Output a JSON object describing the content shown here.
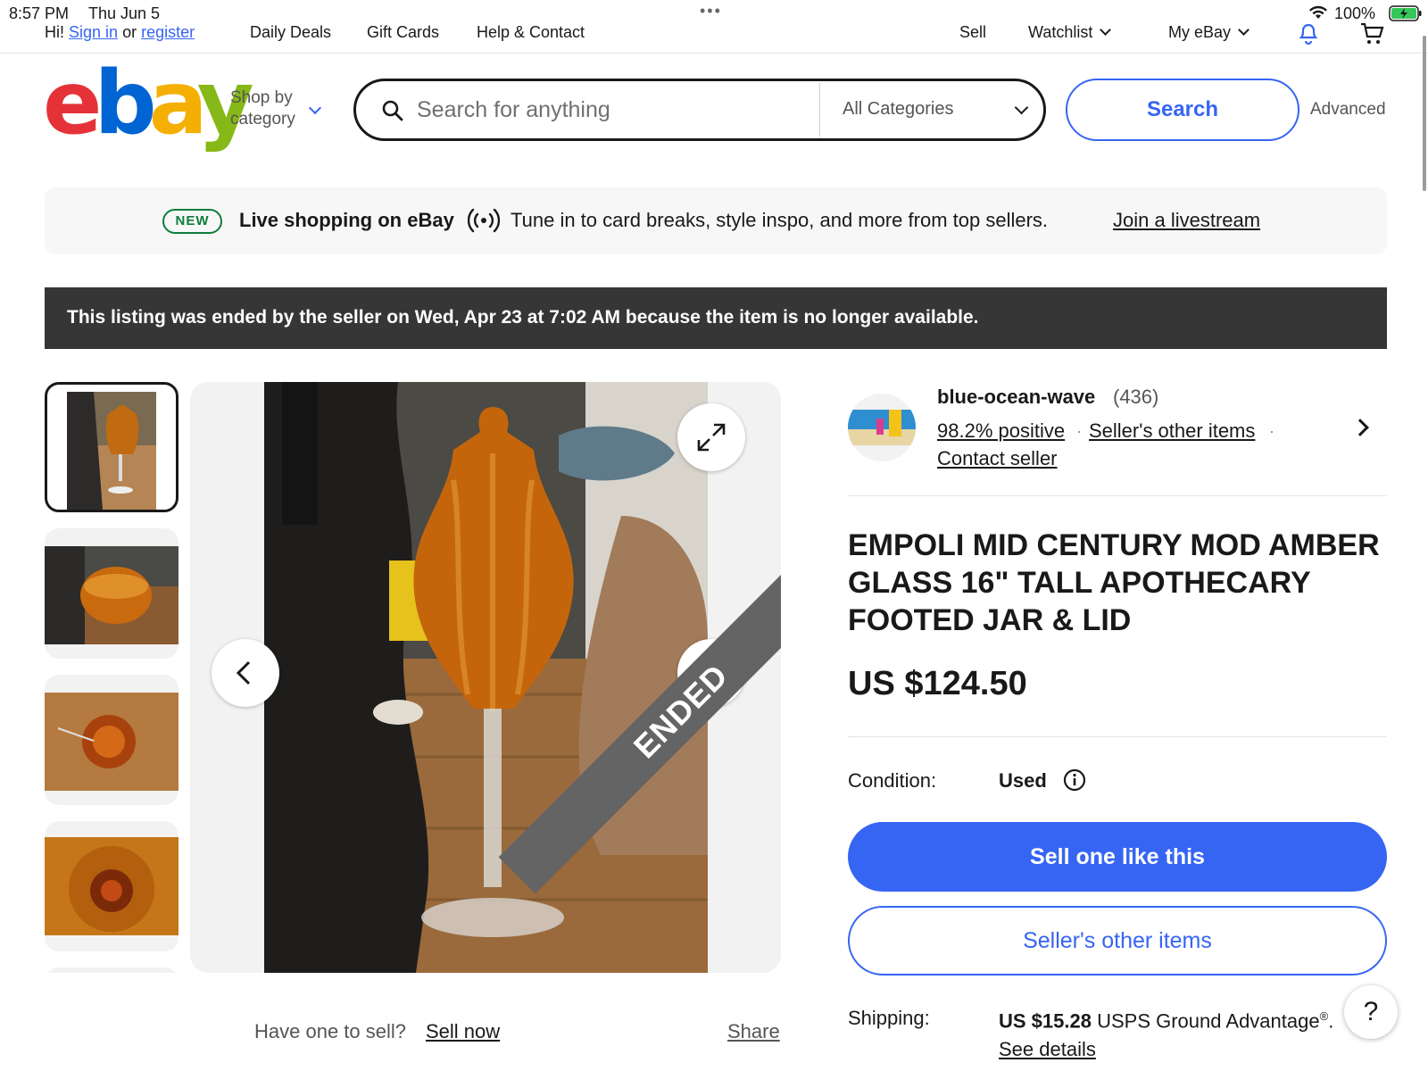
{
  "status_bar": {
    "time": "8:57 PM",
    "date": "Thu Jun 5",
    "battery": "100%"
  },
  "top_nav": {
    "greeting": "Hi!",
    "sign_in": "Sign in",
    "or": "or",
    "register": "register",
    "daily_deals": "Daily Deals",
    "gift_cards": "Gift Cards",
    "help_contact": "Help & Contact",
    "sell": "Sell",
    "watchlist": "Watchlist",
    "my_ebay": "My eBay"
  },
  "header": {
    "logo": [
      "e",
      "b",
      "a",
      "y"
    ],
    "shop_by_line1": "Shop by",
    "shop_by_line2": "category",
    "search_placeholder": "Search for anything",
    "category_selected": "All Categories",
    "search_button": "Search",
    "advanced": "Advanced"
  },
  "live_banner": {
    "badge": "NEW",
    "title": "Live shopping on eBay",
    "description": "Tune in to card breaks, style inspo, and more from top sellers.",
    "link": "Join a livestream"
  },
  "ended_notice": "This listing was ended by the seller on Wed, Apr 23 at 7:02 AM because the item is no longer available.",
  "gallery": {
    "ended_label": "ENDED",
    "have_one": "Have one to sell?",
    "sell_now": "Sell now",
    "share": "Share"
  },
  "seller": {
    "name": "blue-ocean-wave",
    "score": "(436)",
    "positive": "98.2% positive",
    "other_items": "Seller's other items",
    "contact": "Contact seller"
  },
  "item": {
    "title": "EMPOLI MID CENTURY MOD AMBER GLASS 16\" TALL APOTHECARY FOOTED JAR & LID",
    "price": "US $124.50",
    "condition_label": "Condition:",
    "condition_value": "Used",
    "sell_one_like_this": "Sell one like this",
    "sellers_other_items": "Seller's other items",
    "shipping_label": "Shipping:",
    "shipping_price": "US $15.28",
    "shipping_service": "USPS Ground Advantage",
    "shipping_mark": "®",
    "see_details": "See details"
  },
  "help": "?",
  "colors": {
    "accent": "#3665f3",
    "ended_bar": "#363636",
    "new_badge": "#0e7d3a"
  }
}
